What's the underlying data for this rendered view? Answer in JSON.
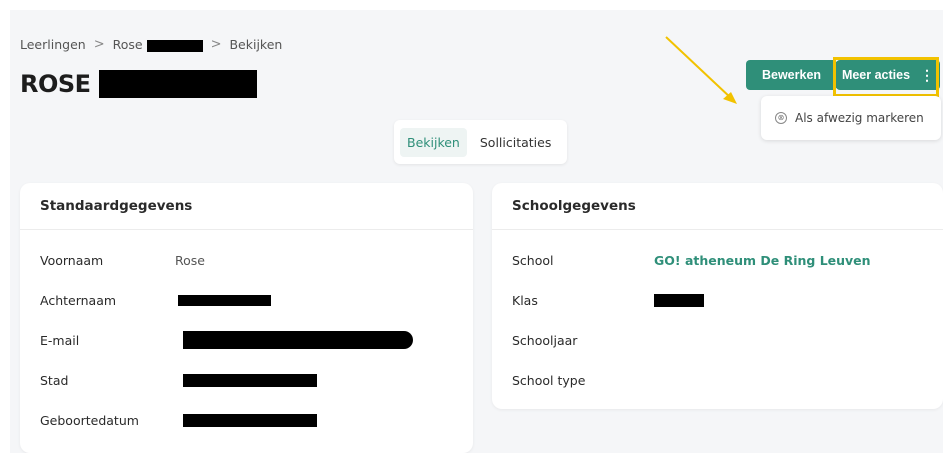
{
  "breadcrumb": {
    "item1": "Leerlingen",
    "separator": ">",
    "item2": "Rose",
    "item3": "Bekijken"
  },
  "page_title": "ROSE",
  "buttons": {
    "edit": "Bewerken",
    "more": "Meer acties",
    "more_icon": "⋮"
  },
  "dropdown": {
    "icon": "⊗",
    "item": "Als afwezig markeren"
  },
  "tabs": {
    "view": "Bekijken",
    "applications": "Sollicitaties"
  },
  "left_card": {
    "title": "Standaardgegevens",
    "rows": [
      {
        "label": "Voornaam",
        "value": "Rose"
      },
      {
        "label": "Achternaam",
        "value": ""
      },
      {
        "label": "E-mail",
        "value": ""
      },
      {
        "label": "Stad",
        "value": ""
      },
      {
        "label": "Geboortedatum",
        "value": ""
      }
    ]
  },
  "right_card": {
    "title": "Schoolgegevens",
    "rows": [
      {
        "label": "School",
        "value": "GO! atheneum De Ring Leuven"
      },
      {
        "label": "Klas",
        "value": ""
      },
      {
        "label": "Schooljaar",
        "value": ""
      },
      {
        "label": "School type",
        "value": ""
      }
    ]
  },
  "colors": {
    "accent": "#2f8f79",
    "highlight": "#f2c200"
  }
}
